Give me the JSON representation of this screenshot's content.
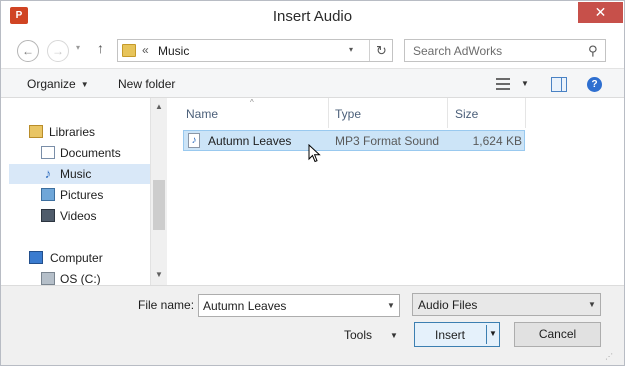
{
  "window": {
    "title": "Insert Audio",
    "app_icon_text": "P",
    "close_glyph": "✕"
  },
  "navbar": {
    "back_glyph": "←",
    "forward_glyph": "→",
    "recent_glyph": "▾",
    "up_glyph": "↑",
    "breadcrumb_sep": "«",
    "breadcrumb_current": "Music",
    "address_drop_glyph": "▾",
    "refresh_glyph": "↻",
    "search_placeholder": "Search AdWorks",
    "search_glyph": "⚲"
  },
  "toolbar": {
    "organize_label": "Organize",
    "new_folder_label": "New folder",
    "caret": "▼",
    "help_glyph": "?"
  },
  "nav_tree": {
    "items": [
      {
        "label": "Libraries",
        "icon": "libraries-icon"
      },
      {
        "label": "Documents",
        "icon": "documents-icon"
      },
      {
        "label": "Music",
        "icon": "music-icon",
        "selected": true
      },
      {
        "label": "Pictures",
        "icon": "pictures-icon"
      },
      {
        "label": "Videos",
        "icon": "videos-icon"
      },
      {
        "label": "Computer",
        "icon": "computer-icon"
      },
      {
        "label": "OS (C:)",
        "icon": "drive-icon"
      }
    ],
    "music_glyph": "♪",
    "scroll_up_glyph": "▲",
    "scroll_down_glyph": "▼"
  },
  "file_list": {
    "columns": {
      "name": "Name",
      "type": "Type",
      "size": "Size"
    },
    "sort_glyph": "^",
    "rows": [
      {
        "name": "Autumn Leaves",
        "type": "MP3 Format Sound",
        "size": "1,624 KB",
        "selected": true
      }
    ],
    "file_glyph": "♪"
  },
  "bottom": {
    "file_name_label": "File name:",
    "file_name_value": "Autumn Leaves",
    "file_type_value": "Audio Files",
    "tools_label": "Tools",
    "insert_label": "Insert",
    "cancel_label": "Cancel",
    "drop_glyph": "▼",
    "grip_glyph": "⋰"
  },
  "colors": {
    "selection": "#cce4f7",
    "accent": "#3c7fb1",
    "close": "#c7504a"
  }
}
